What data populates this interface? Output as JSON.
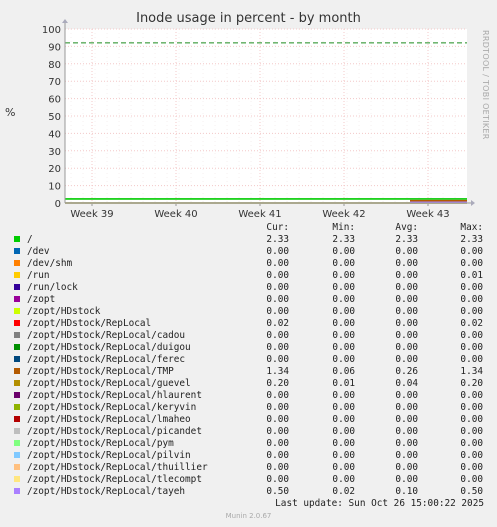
{
  "chart_data": {
    "type": "line",
    "title": "Inode usage in percent - by month",
    "ylabel": "%",
    "side_label": "RRDTOOL / TOBI OETIKER",
    "ylim": [
      0,
      100
    ],
    "y_ticks": [
      "0",
      "10",
      "20",
      "30",
      "40",
      "50",
      "60",
      "70",
      "80",
      "90",
      "100"
    ],
    "x_ticks": [
      "Week 39",
      "Week 40",
      "Week 41",
      "Week 42",
      "Week 43"
    ],
    "warning_level": 92,
    "columns": {
      "cur": "Cur:",
      "min": "Min:",
      "avg": "Avg:",
      "max": "Max:"
    },
    "series": [
      {
        "name": "/",
        "color": "#00cc00",
        "cur": "2.33",
        "min": "2.33",
        "avg": "2.33",
        "max": "2.33"
      },
      {
        "name": "/dev",
        "color": "#0066b3",
        "cur": "0.00",
        "min": "0.00",
        "avg": "0.00",
        "max": "0.00"
      },
      {
        "name": "/dev/shm",
        "color": "#ff8000",
        "cur": "0.00",
        "min": "0.00",
        "avg": "0.00",
        "max": "0.00"
      },
      {
        "name": "/run",
        "color": "#ffcc00",
        "cur": "0.00",
        "min": "0.00",
        "avg": "0.00",
        "max": "0.01"
      },
      {
        "name": "/run/lock",
        "color": "#330099",
        "cur": "0.00",
        "min": "0.00",
        "avg": "0.00",
        "max": "0.00"
      },
      {
        "name": "/zopt",
        "color": "#990099",
        "cur": "0.00",
        "min": "0.00",
        "avg": "0.00",
        "max": "0.00"
      },
      {
        "name": "/zopt/HDstock",
        "color": "#ccff00",
        "cur": "0.00",
        "min": "0.00",
        "avg": "0.00",
        "max": "0.00"
      },
      {
        "name": "/zopt/HDstock/RepLocal",
        "color": "#ff0000",
        "cur": "0.02",
        "min": "0.00",
        "avg": "0.00",
        "max": "0.02"
      },
      {
        "name": "/zopt/HDstock/RepLocal/cadou",
        "color": "#808080",
        "cur": "0.00",
        "min": "0.00",
        "avg": "0.00",
        "max": "0.00"
      },
      {
        "name": "/zopt/HDstock/RepLocal/duigou",
        "color": "#008f00",
        "cur": "0.00",
        "min": "0.00",
        "avg": "0.00",
        "max": "0.00"
      },
      {
        "name": "/zopt/HDstock/RepLocal/ferec",
        "color": "#00487d",
        "cur": "0.00",
        "min": "0.00",
        "avg": "0.00",
        "max": "0.00"
      },
      {
        "name": "/zopt/HDstock/RepLocal/TMP",
        "color": "#b35a00",
        "cur": "1.34",
        "min": "0.06",
        "avg": "0.26",
        "max": "1.34"
      },
      {
        "name": "/zopt/HDstock/RepLocal/guevel",
        "color": "#b38f00",
        "cur": "0.20",
        "min": "0.01",
        "avg": "0.04",
        "max": "0.20"
      },
      {
        "name": "/zopt/HDstock/RepLocal/hlaurent",
        "color": "#6b006b",
        "cur": "0.00",
        "min": "0.00",
        "avg": "0.00",
        "max": "0.00"
      },
      {
        "name": "/zopt/HDstock/RepLocal/keryvin",
        "color": "#8fb300",
        "cur": "0.00",
        "min": "0.00",
        "avg": "0.00",
        "max": "0.00"
      },
      {
        "name": "/zopt/HDstock/RepLocal/lmaheo",
        "color": "#b30000",
        "cur": "0.00",
        "min": "0.00",
        "avg": "0.00",
        "max": "0.00"
      },
      {
        "name": "/zopt/HDstock/RepLocal/picandet",
        "color": "#bebebe",
        "cur": "0.00",
        "min": "0.00",
        "avg": "0.00",
        "max": "0.00"
      },
      {
        "name": "/zopt/HDstock/RepLocal/pym",
        "color": "#80ff80",
        "cur": "0.00",
        "min": "0.00",
        "avg": "0.00",
        "max": "0.00"
      },
      {
        "name": "/zopt/HDstock/RepLocal/pilvin",
        "color": "#80c9ff",
        "cur": "0.00",
        "min": "0.00",
        "avg": "0.00",
        "max": "0.00"
      },
      {
        "name": "/zopt/HDstock/RepLocal/thuillier",
        "color": "#ffc080",
        "cur": "0.00",
        "min": "0.00",
        "avg": "0.00",
        "max": "0.00"
      },
      {
        "name": "/zopt/HDstock/RepLocal/tlecompt",
        "color": "#ffe680",
        "cur": "0.00",
        "min": "0.00",
        "avg": "0.00",
        "max": "0.00"
      },
      {
        "name": "/zopt/HDstock/RepLocal/tayeh",
        "color": "#aa80ff",
        "cur": "0.50",
        "min": "0.02",
        "avg": "0.10",
        "max": "0.50"
      }
    ]
  },
  "last_update": "Last update: Sun Oct 26 15:00:22 2025",
  "footer": "Munin 2.0.67"
}
